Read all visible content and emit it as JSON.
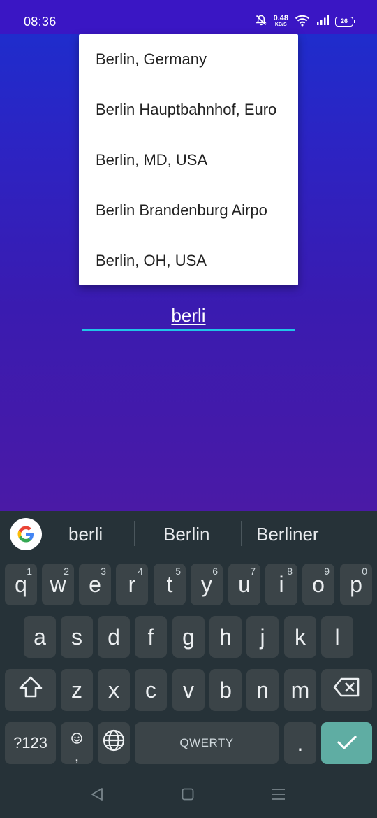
{
  "status_bar": {
    "time": "08:36",
    "net_speed_value": "0.48",
    "net_speed_unit": "KB/S",
    "battery": "26",
    "icons": [
      "mute-icon",
      "wifi-icon",
      "signal-icon",
      "battery-icon"
    ]
  },
  "autocomplete": {
    "items": [
      "Berlin, Germany",
      "Berlin Hauptbahnhof, Euro",
      "Berlin, MD, USA",
      "Berlin Brandenburg Airpo",
      "Berlin, OH, USA"
    ]
  },
  "search": {
    "value": "berli",
    "accent_color": "#20c4e8"
  },
  "keyboard": {
    "suggestions": [
      "berli",
      "Berlin",
      "Berliner"
    ],
    "row1": [
      {
        "label": "q",
        "hint": "1"
      },
      {
        "label": "w",
        "hint": "2"
      },
      {
        "label": "e",
        "hint": "3"
      },
      {
        "label": "r",
        "hint": "4"
      },
      {
        "label": "t",
        "hint": "5"
      },
      {
        "label": "y",
        "hint": "6"
      },
      {
        "label": "u",
        "hint": "7"
      },
      {
        "label": "i",
        "hint": "8"
      },
      {
        "label": "o",
        "hint": "9"
      },
      {
        "label": "p",
        "hint": "0"
      }
    ],
    "row2": [
      "a",
      "s",
      "d",
      "f",
      "g",
      "h",
      "j",
      "k",
      "l"
    ],
    "row3": [
      "z",
      "x",
      "c",
      "v",
      "b",
      "n",
      "m"
    ],
    "symbols_label": "?123",
    "comma_label": ",",
    "space_label": "QWERTY",
    "period_label": ".",
    "enter_color": "#5fada3"
  },
  "colors": {
    "background_top": "#1b2fcf",
    "background_bottom": "#4a1aa6",
    "keyboard_bg": "#263238",
    "key_bg": "#3b4448"
  }
}
